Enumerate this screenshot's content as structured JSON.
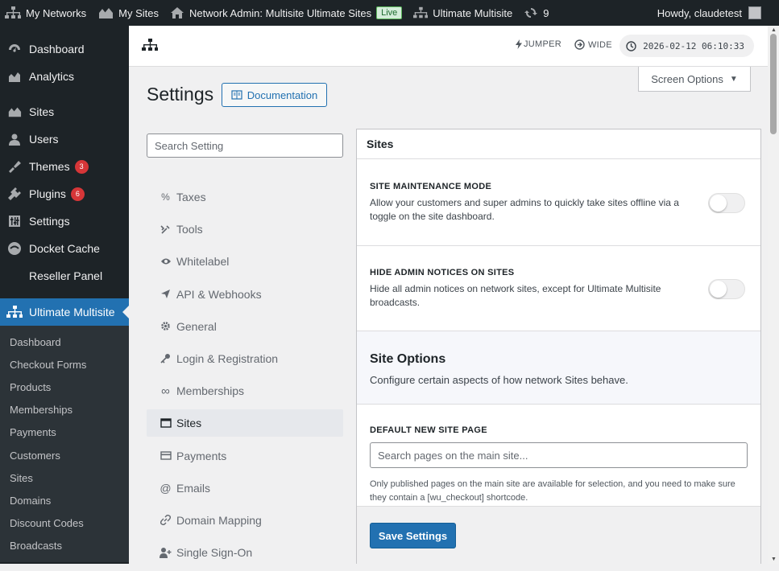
{
  "adminbar": {
    "my_networks": "My Networks",
    "my_sites": "My Sites",
    "network_admin": "Network Admin: Multisite Ultimate Sites",
    "live_badge": "Live",
    "ultimate_multisite": "Ultimate Multisite",
    "updates_count": "9",
    "howdy": "Howdy, claudetest"
  },
  "sidebar": {
    "items": [
      {
        "label": "Dashboard",
        "icon": "dashboard-icon"
      },
      {
        "label": "Analytics",
        "icon": "analytics-icon"
      },
      {
        "label": "Sites",
        "icon": "sites-icon"
      },
      {
        "label": "Users",
        "icon": "users-icon"
      },
      {
        "label": "Themes",
        "icon": "themes-icon",
        "badge": "3"
      },
      {
        "label": "Plugins",
        "icon": "plugins-icon",
        "badge": "6"
      },
      {
        "label": "Settings",
        "icon": "settings-icon"
      },
      {
        "label": "Docket Cache",
        "icon": "docket-cache-icon"
      },
      {
        "label": "Reseller Panel",
        "icon": ""
      },
      {
        "label": "Ultimate Multisite",
        "icon": "network-icon"
      }
    ],
    "submenu": [
      "Dashboard",
      "Checkout Forms",
      "Products",
      "Memberships",
      "Payments",
      "Customers",
      "Sites",
      "Domains",
      "Discount Codes",
      "Broadcasts"
    ]
  },
  "topbar": {
    "jumper": "JUMPER",
    "wide": "WIDE",
    "clock": "2026-02-12 06:10:33"
  },
  "page": {
    "screen_options": "Screen Options",
    "title": "Settings",
    "documentation": "Documentation",
    "search_placeholder": "Search Setting"
  },
  "settings_nav": [
    {
      "label": "Taxes",
      "icon": "percent-icon"
    },
    {
      "label": "Tools",
      "icon": "tools-icon"
    },
    {
      "label": "Whitelabel",
      "icon": "eye-icon"
    },
    {
      "label": "API & Webhooks",
      "icon": "send-icon"
    },
    {
      "label": "General",
      "icon": "gear-icon"
    },
    {
      "label": "Login & Registration",
      "icon": "key-icon"
    },
    {
      "label": "Memberships",
      "icon": "infinity-icon"
    },
    {
      "label": "Sites",
      "icon": "browser-icon"
    },
    {
      "label": "Payments",
      "icon": "credit-card-icon"
    },
    {
      "label": "Emails",
      "icon": "at-icon"
    },
    {
      "label": "Domain Mapping",
      "icon": "link-icon"
    },
    {
      "label": "Single Sign-On",
      "icon": "user-plus-icon"
    }
  ],
  "panel": {
    "heading": "Sites",
    "maintenance": {
      "title": "Site Maintenance Mode",
      "desc": "Allow your customers and super admins to quickly take sites offline via a toggle on the site dashboard.",
      "enabled": false
    },
    "hide_notices": {
      "title": "Hide Admin Notices on Sites",
      "desc": "Hide all admin notices on network sites, except for Ultimate Multisite broadcasts.",
      "enabled": false
    },
    "site_options": {
      "title": "Site Options",
      "desc": "Configure certain aspects of how network Sites behave."
    },
    "default_page": {
      "title": "Default New Site Page",
      "placeholder": "Search pages on the main site...",
      "note": "Only published pages on the main site are available for selection, and you need to make sure they contain a [wu_checkout] shortcode."
    },
    "save": "Save Settings"
  }
}
